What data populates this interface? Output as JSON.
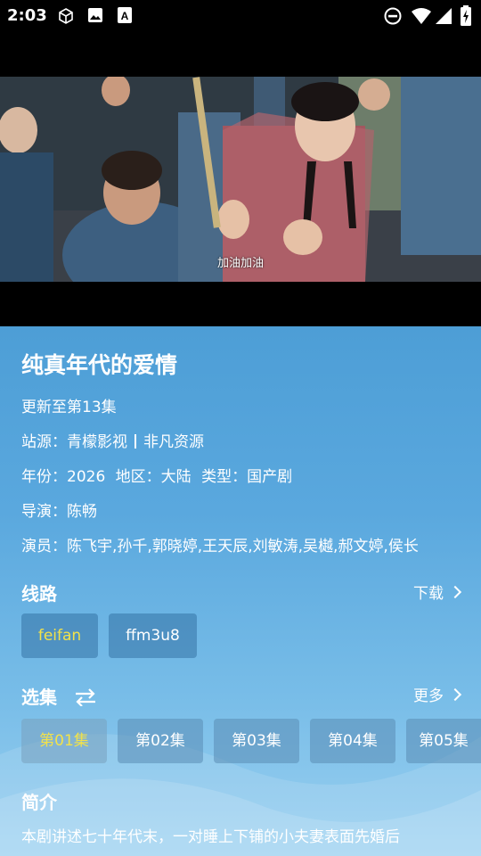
{
  "status_bar": {
    "time": "2:03",
    "icons": [
      "cube-icon",
      "image-icon",
      "a-icon",
      "dnd-icon",
      "wifi-icon",
      "signal-icon",
      "battery-icon"
    ]
  },
  "video": {
    "subtitle": "加油加油"
  },
  "detail": {
    "title": "纯真年代的爱情",
    "update": "更新至第13集",
    "source_label": "站源：",
    "source_value1": "青檬影视",
    "source_value2": "非凡资源",
    "year_label": "年份：",
    "year": "2026",
    "region_label": "地区：",
    "region": "大陆",
    "type_label": "类型：",
    "type": "国产剧",
    "director_label": "导演：",
    "director": "陈畅",
    "cast_label": "演员：",
    "cast": "陈飞宇,孙千,郭晓婷,王天辰,刘敏涛,吴樾,郝文婷,侯长"
  },
  "routes": {
    "title": "线路",
    "link": "下载",
    "items": [
      "feifan",
      "ffm3u8"
    ]
  },
  "episodes": {
    "title": "选集",
    "link": "更多",
    "items": [
      "第01集",
      "第02集",
      "第03集",
      "第04集",
      "第05集"
    ]
  },
  "intro": {
    "title": "简介",
    "text": "本剧讲述七十年代末，一对睡上下铺的小夫妻表面先婚后"
  },
  "colors": {
    "accent_selected": "#f2e24a",
    "panel_top": "#4d9ed6",
    "panel_bottom": "#9ad0f0"
  }
}
